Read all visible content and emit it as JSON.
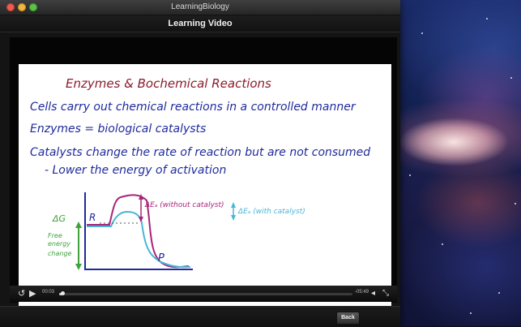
{
  "window": {
    "title": "LearningBiology"
  },
  "header": {
    "title": "Learning Video"
  },
  "video": {
    "title": "Enzymes & Bochemical Reactions",
    "lines": [
      "Cells carry out chemical reactions in a controlled manner",
      "Enzymes = biological catalysts",
      "Catalysts change the rate of reaction but are not consumed",
      "- Lower the energy of activation"
    ],
    "diagram": {
      "dg_label": "ΔG",
      "free_energy_label": [
        "Free",
        "energy",
        "change"
      ],
      "reactant_label": "R",
      "product_label": "P",
      "without_catalyst_label": "ΔEₐ (without catalyst)",
      "with_catalyst_label": "ΔEₐ (with catalyst)"
    },
    "colors": {
      "title": "#8b1a2a",
      "text": "#1f2a9c",
      "green": "#3fa33a",
      "magenta": "#a8247a",
      "cyan": "#49b6d6"
    }
  },
  "controls": {
    "current_time": "00:03",
    "remaining_time": "-05:49",
    "progress": 0.01,
    "icons": [
      "replay-icon",
      "play-icon",
      "volume-icon",
      "fullscreen-icon"
    ]
  },
  "footer": {
    "back_label": "Back"
  }
}
